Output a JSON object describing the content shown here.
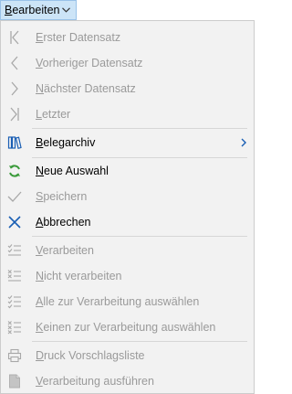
{
  "menu": {
    "title": "Bearbeiten",
    "items": [
      {
        "label": "Erster Datensatz",
        "icon": "first-record-icon",
        "enabled": false
      },
      {
        "label": "Vorheriger Datensatz",
        "icon": "previous-record-icon",
        "enabled": false
      },
      {
        "label": "Nächster Datensatz",
        "icon": "next-record-icon",
        "enabled": false
      },
      {
        "label": "Letzter",
        "icon": "last-record-icon",
        "enabled": false
      },
      {
        "label": "Belegarchiv",
        "icon": "archive-books-icon",
        "enabled": true,
        "submenu": true
      },
      {
        "label": "Neue Auswahl",
        "icon": "refresh-icon",
        "enabled": true
      },
      {
        "label": "Speichern",
        "icon": "checkmark-icon",
        "enabled": false
      },
      {
        "label": "Abbrechen",
        "icon": "cancel-x-icon",
        "enabled": true
      },
      {
        "label": "Verarbeiten",
        "icon": "process-list-icon",
        "enabled": false
      },
      {
        "label": "Nicht verarbeiten",
        "icon": "dont-process-list-icon",
        "enabled": false
      },
      {
        "label": "Alle zur Verarbeitung auswählen",
        "icon": "select-all-list-icon",
        "enabled": false
      },
      {
        "label": "Keinen zur Verarbeitung auswählen",
        "icon": "select-none-list-icon",
        "enabled": false
      },
      {
        "label": "Druck Vorschlagsliste",
        "icon": "printer-icon",
        "enabled": false
      },
      {
        "label": "Verarbeitung ausführen",
        "icon": "document-icon",
        "enabled": false
      }
    ]
  },
  "colors": {
    "accent_blue": "#1a5fb4",
    "refresh_green": "#3a9a3a",
    "disabled_text": "#9a9a9a",
    "menu_head_bg": "#cce4f7"
  }
}
